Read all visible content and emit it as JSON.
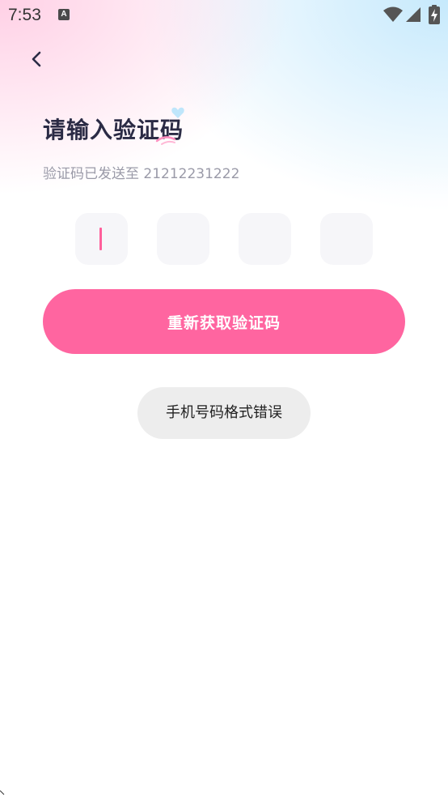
{
  "status_bar": {
    "time": "7:53",
    "notification_glyph": "A"
  },
  "page": {
    "title": "请输入验证码",
    "subtitle": "验证码已发送至 21212231222"
  },
  "code_inputs": [
    {
      "value": "",
      "focused": true
    },
    {
      "value": "",
      "focused": false
    },
    {
      "value": "",
      "focused": false
    },
    {
      "value": "",
      "focused": false
    }
  ],
  "resend_button": {
    "label": "重新获取验证码"
  },
  "toast": {
    "message": "手机号码格式错误"
  },
  "colors": {
    "accent": "#ff65a0",
    "caret": "#ff5f9b",
    "title": "#2b2b45",
    "subtitle": "#9a9aa8",
    "input_bg": "#f6f6f9",
    "toast_bg": "#ededed"
  },
  "icons": {
    "back": "chevron-left-icon",
    "wifi": "wifi-icon",
    "signal": "cell-signal-icon",
    "battery": "battery-charging-icon"
  }
}
